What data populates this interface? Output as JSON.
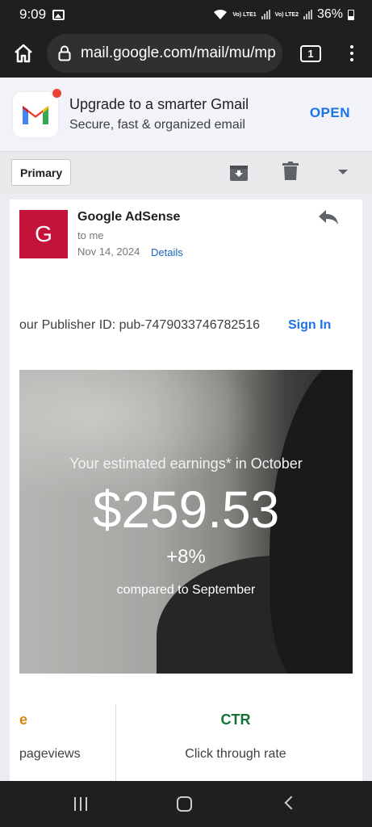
{
  "status_bar": {
    "time": "9:09",
    "battery": "36%",
    "sim1": "Vo) LTE1",
    "sim2": "Vo) LTE2"
  },
  "browser": {
    "url": "mail.google.com/mail/mu/mp",
    "tab_count": "1",
    "icons": [
      "home-icon",
      "lock-icon",
      "tabs-icon",
      "more-vert-icon"
    ]
  },
  "promo": {
    "title": "Upgrade to a smarter Gmail",
    "subtitle": "Secure, fast & organized email",
    "open_label": "OPEN"
  },
  "toolbar": {
    "label": "Primary",
    "icons": [
      "archive-icon",
      "trash-icon",
      "dropdown-icon"
    ]
  },
  "email": {
    "avatar_letter": "G",
    "sender": "Google AdSense",
    "recipient": "to me",
    "date": "Nov 14, 2024",
    "details_label": "Details",
    "publisher_line": "our Publisher ID: pub-7479033746782516",
    "sign_in_label": "Sign In",
    "earnings_label": "Your estimated earnings* in October",
    "earnings_amount": "$259.53",
    "earnings_change": "+8%",
    "earnings_compare": "compared to September",
    "metric_left_title": "e",
    "metric_left_sub": "pageviews",
    "metric_right_title": "CTR",
    "metric_right_sub": "Click through rate"
  },
  "colors": {
    "avatar": "#c4133b",
    "link": "#1a73e8",
    "ctr": "#137333",
    "metric_left": "#d48b0b"
  }
}
